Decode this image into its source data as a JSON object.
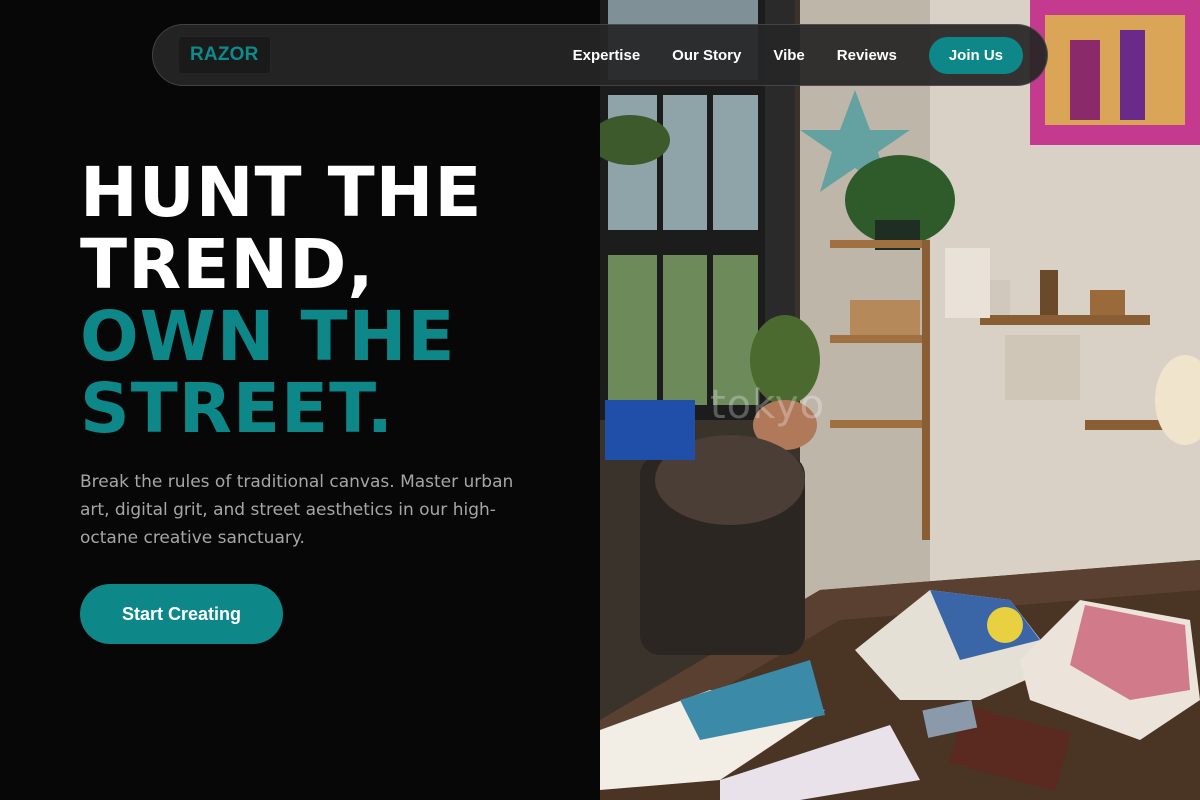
{
  "brand": {
    "logo": "RAZOR",
    "accent_color": "#0e8789"
  },
  "nav": {
    "links": [
      "Expertise",
      "Our Story",
      "Vibe",
      "Reviews"
    ],
    "cta_label": "Join Us"
  },
  "hero": {
    "headline_white": [
      "HUNT THE",
      "TREND,"
    ],
    "headline_teal": [
      "OWN THE",
      "STREET."
    ],
    "subtitle": "Break the rules of traditional canvas. Master urban art, digital grit, and street aesthetics in our high-octane creative sanctuary.",
    "cta_label": "Start Creating"
  },
  "image": {
    "watermark": "tokyo"
  }
}
